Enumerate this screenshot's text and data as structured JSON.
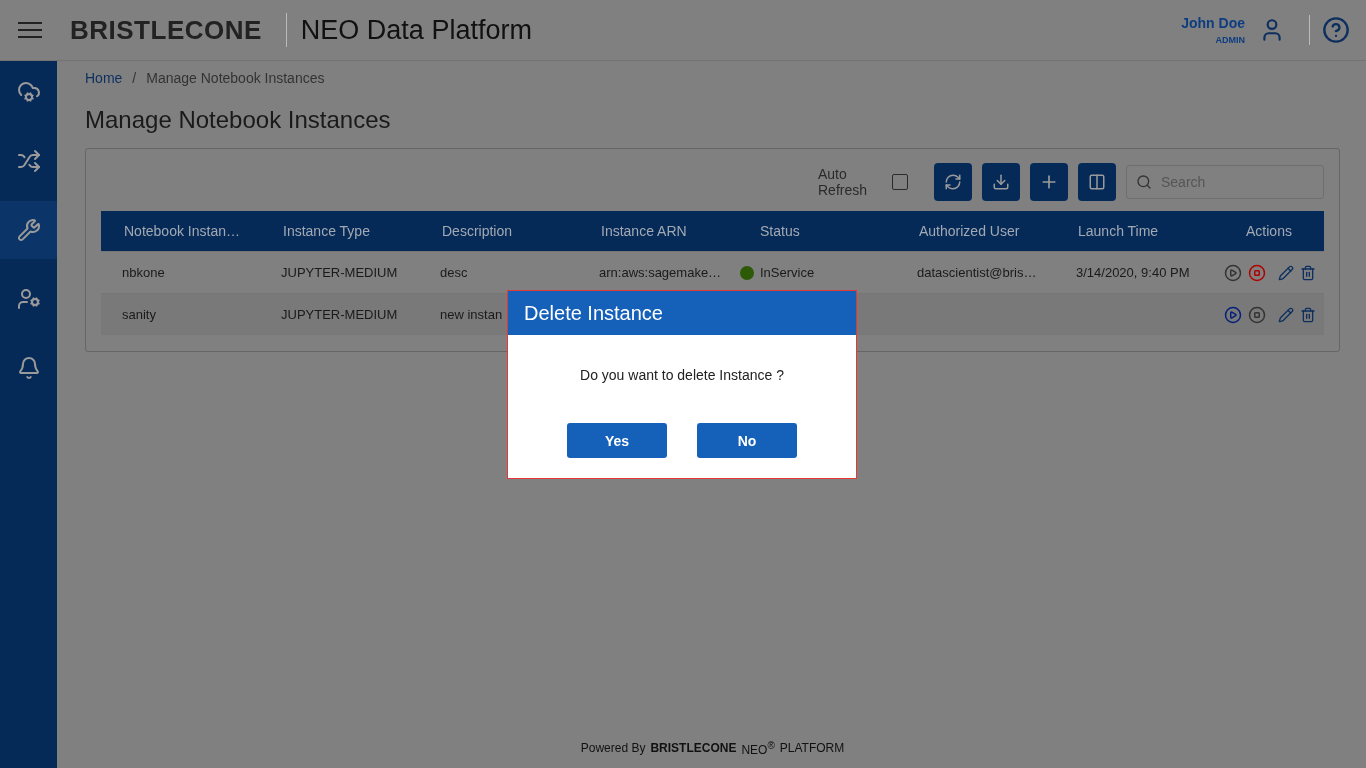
{
  "header": {
    "logo": "BRISTLECONE",
    "title": "NEO Data Platform",
    "user": {
      "name": "John Doe",
      "role": "ADMIN"
    }
  },
  "sidebar": {
    "items": [
      {
        "kind": "cloud",
        "selected": false
      },
      {
        "kind": "flows",
        "selected": false
      },
      {
        "kind": "tools",
        "selected": true
      },
      {
        "kind": "user-lock",
        "selected": false
      },
      {
        "kind": "bell",
        "selected": false
      }
    ]
  },
  "breadcrumb": [
    "Home",
    "/",
    "Manage Notebook Instances"
  ],
  "page_title": "Manage Notebook Instances",
  "toolbar": {
    "auto_refresh": {
      "label": "Auto Refresh",
      "checked": false
    },
    "search": {
      "placeholder": "Search"
    }
  },
  "table": {
    "columns": [
      "Notebook Instan…",
      "Instance Type",
      "Description",
      "Instance ARN",
      "Status",
      "Authorized User",
      "Launch Time",
      "Actions"
    ],
    "rows": [
      {
        "name": "nbkone",
        "type": "JUPYTER-MEDIUM",
        "description": "desc",
        "arn": "arn:aws:sagemake…",
        "status": {
          "label": "InService",
          "color": "#2d5a06"
        },
        "user": "datascientist@bris…",
        "launch": "3/14/2020, 9:40 PM",
        "running": true
      },
      {
        "name": "sanity",
        "type": "JUPYTER-MEDIUM",
        "description": "new instan",
        "running": false
      }
    ]
  },
  "dialog": {
    "title": "Delete Instance",
    "message": "Do you want to delete Instance ?",
    "buttons": [
      "Yes",
      "No"
    ]
  },
  "footer": {
    "powered": "Powered By",
    "logo": "BRISTLECONE",
    "product": "NEO$^{®}$",
    "platform": "PLATFORM"
  }
}
